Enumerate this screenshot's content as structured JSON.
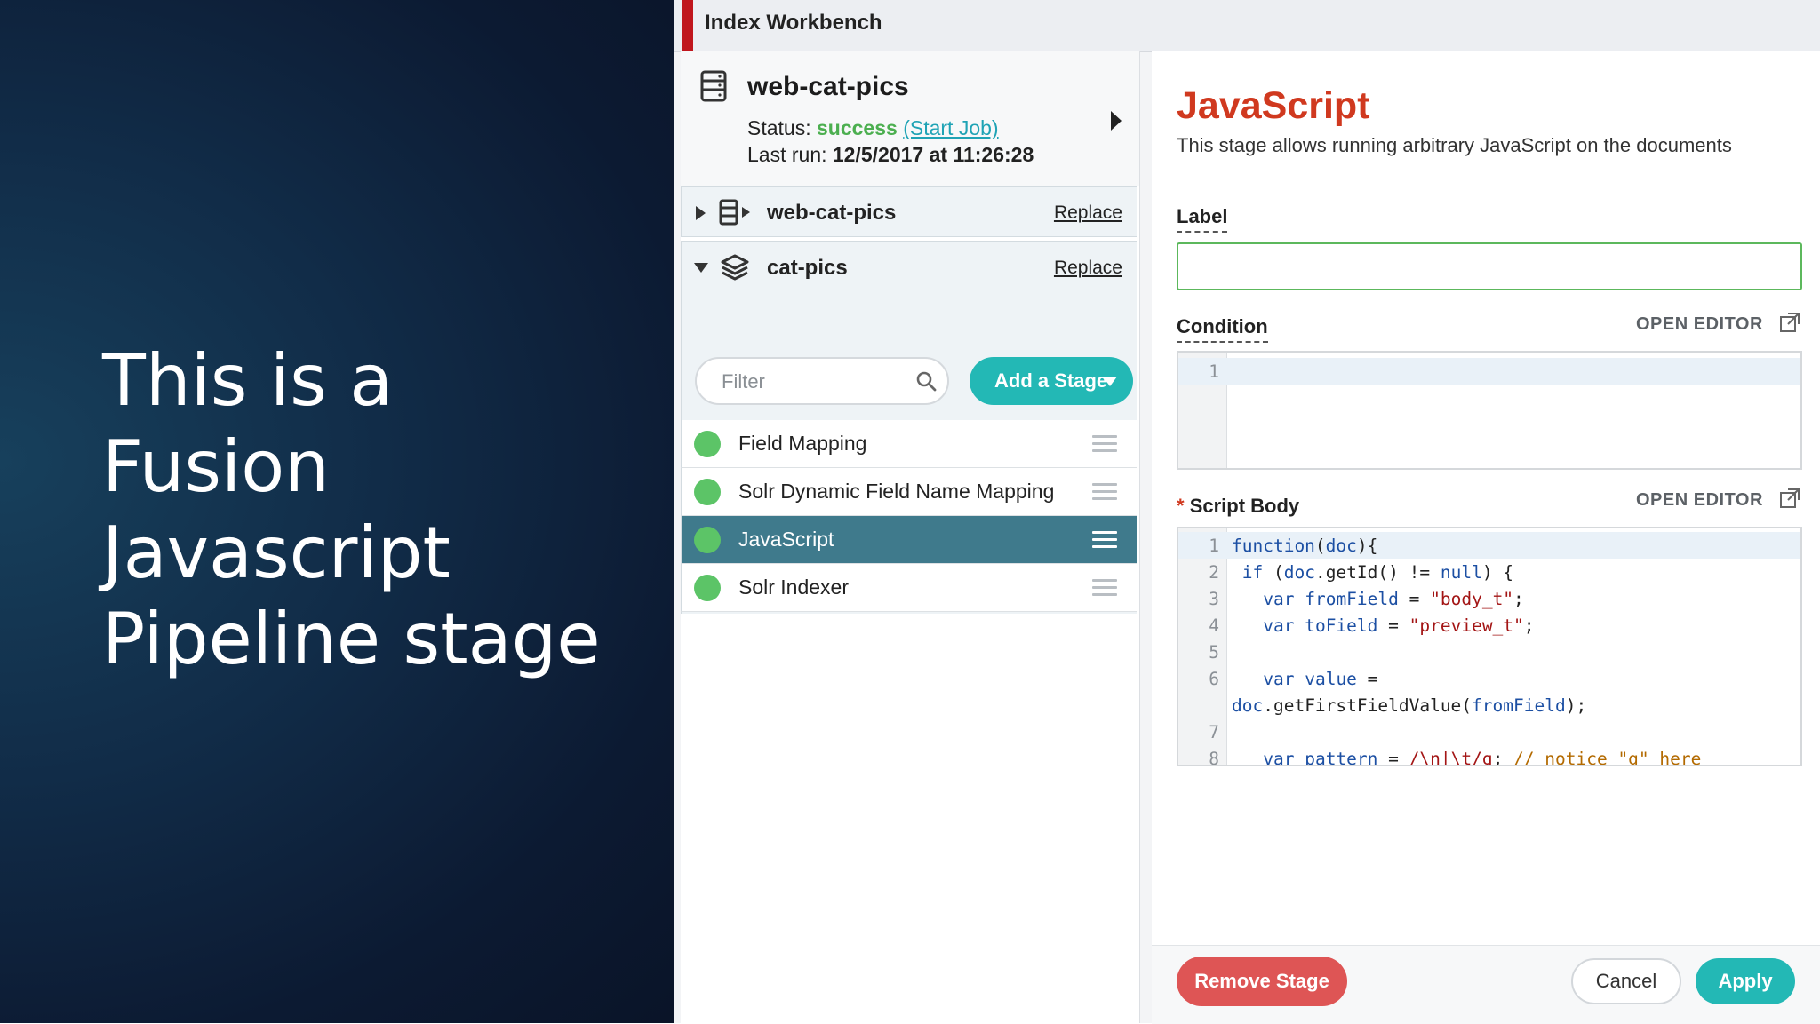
{
  "slide": {
    "lines": [
      "This is a",
      "Fusion",
      "Javascript",
      "Pipeline stage"
    ]
  },
  "app": {
    "title": "Index Workbench",
    "accent_color": "#c0161d"
  },
  "job": {
    "icon": "database-icon",
    "name": "web-cat-pics",
    "status_label": "Status:",
    "status_value": "success",
    "start_job_link": "(Start Job)",
    "last_run_label": "Last run:",
    "last_run_value": "12/5/2017 at 11:26:28"
  },
  "datasource": {
    "icon": "datasource-icon",
    "name": "web-cat-pics",
    "replace_label": "Replace"
  },
  "pipeline": {
    "icon": "layers-icon",
    "name": "cat-pics",
    "replace_label": "Replace"
  },
  "filter": {
    "placeholder": "Filter"
  },
  "add_stage": {
    "label": "Add a Stage"
  },
  "stages": [
    {
      "name": "Field Mapping",
      "selected": false
    },
    {
      "name": "Solr Dynamic Field Name Mapping",
      "selected": false
    },
    {
      "name": "JavaScript",
      "selected": true
    },
    {
      "name": "Solr Indexer",
      "selected": false
    }
  ],
  "editor": {
    "title": "JavaScript",
    "description": "This stage allows running arbitrary JavaScript on the documents",
    "label_field": {
      "label": "Label",
      "value": ""
    },
    "condition": {
      "label": "Condition",
      "open_editor": "OPEN EDITOR",
      "line_numbers": [
        "1"
      ]
    },
    "script_body": {
      "required_marker": "*",
      "label": "Script Body",
      "open_editor": "OPEN EDITOR",
      "line_numbers": [
        "1",
        "2",
        "3",
        "4",
        "5",
        "6",
        "",
        "7",
        "8"
      ]
    }
  },
  "footer": {
    "remove_label": "Remove Stage",
    "cancel_label": "Cancel",
    "apply_label": "Apply"
  },
  "colors": {
    "primary": "#23b8b5",
    "danger": "#de5555",
    "title_red": "#d0391f",
    "success": "#4caf50",
    "selected_row": "#3f7a8c"
  }
}
